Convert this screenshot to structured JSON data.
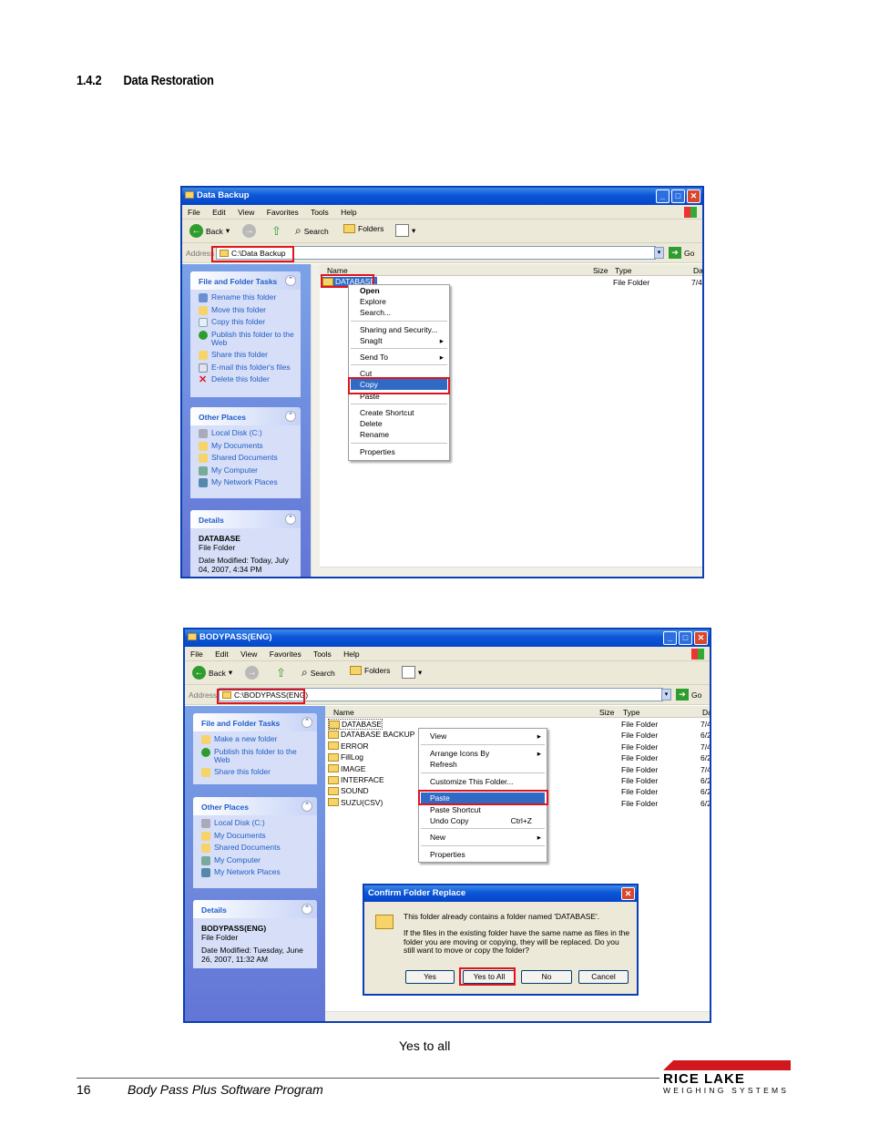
{
  "section": {
    "number": "1.4.2",
    "title": "Data Restoration"
  },
  "win1": {
    "title": "Data Backup",
    "menu": [
      "File",
      "Edit",
      "View",
      "Favorites",
      "Tools",
      "Help"
    ],
    "toolbar": {
      "back": "Back",
      "search": "Search",
      "folders": "Folders"
    },
    "address_label": "Address",
    "address": "C:\\Data Backup",
    "go": "Go",
    "tasks_title": "File and Folder Tasks",
    "tasks": [
      "Rename this folder",
      "Move this folder",
      "Copy this folder",
      "Publish this folder to the Web",
      "Share this folder",
      "E-mail this folder's files",
      "Delete this folder"
    ],
    "other_title": "Other Places",
    "other": [
      "Local Disk (C:)",
      "My Documents",
      "Shared Documents",
      "My Computer",
      "My Network Places"
    ],
    "details_title": "Details",
    "details_name": "DATABASE",
    "details_type": "File Folder",
    "details_date": "Date Modified: Today, July 04, 2007, 4:34 PM",
    "columns": {
      "name": "Name",
      "size": "Size",
      "type": "Type",
      "date": "Da"
    },
    "file": {
      "name": "DATABASE",
      "type": "File Folder",
      "date": "7/4"
    },
    "context": [
      "Open",
      "Explore",
      "Search...",
      "Sharing and Security...",
      "SnagIt",
      "Send To",
      "Cut",
      "Copy",
      "Paste",
      "Create Shortcut",
      "Delete",
      "Rename",
      "Properties"
    ]
  },
  "win2": {
    "title": "BODYPASS(ENG)",
    "menu": [
      "File",
      "Edit",
      "View",
      "Favorites",
      "Tools",
      "Help"
    ],
    "toolbar": {
      "back": "Back",
      "search": "Search",
      "folders": "Folders"
    },
    "address_label": "Address",
    "address": "C:\\BODYPASS(ENG)",
    "go": "Go",
    "tasks_title": "File and Folder Tasks",
    "tasks": [
      "Make a new folder",
      "Publish this folder to the Web",
      "Share this folder"
    ],
    "other_title": "Other Places",
    "other": [
      "Local Disk (C:)",
      "My Documents",
      "Shared Documents",
      "My Computer",
      "My Network Places"
    ],
    "details_title": "Details",
    "details_name": "BODYPASS(ENG)",
    "details_type": "File Folder",
    "details_date": "Date Modified: Tuesday, June 26, 2007, 11:32 AM",
    "columns": {
      "name": "Name",
      "size": "Size",
      "type": "Type",
      "date": "Da"
    },
    "files": [
      {
        "name": "DATABASE",
        "type": "File Folder",
        "date": "7/4"
      },
      {
        "name": "DATABASE BACKUP",
        "type": "File Folder",
        "date": "6/2"
      },
      {
        "name": "ERROR",
        "type": "File Folder",
        "date": "7/4"
      },
      {
        "name": "FillLog",
        "type": "File Folder",
        "date": "6/2"
      },
      {
        "name": "IMAGE",
        "type": "File Folder",
        "date": "7/4"
      },
      {
        "name": "INTERFACE",
        "type": "File Folder",
        "date": "6/2"
      },
      {
        "name": "SOUND",
        "type": "File Folder",
        "date": "6/2"
      },
      {
        "name": "SUZU(CSV)",
        "type": "File Folder",
        "date": "6/2"
      }
    ],
    "context": [
      "View",
      "Arrange Icons By",
      "Refresh",
      "Customize This Folder...",
      "Paste",
      "Paste Shortcut",
      "Undo Copy",
      "New",
      "Properties"
    ],
    "undo_shortcut": "Ctrl+Z",
    "dialog": {
      "title": "Confirm Folder Replace",
      "line1": "This folder already contains a folder named 'DATABASE'.",
      "line2": "If the files in the existing folder have the same name as files in the folder you are moving or copying, they will be replaced.  Do you still want to move or copy the folder?",
      "buttons": [
        "Yes",
        "Yes to All",
        "No",
        "Cancel"
      ]
    }
  },
  "caption": "Yes to all",
  "footer": {
    "page": "16",
    "title": "Body Pass Plus Software Program"
  },
  "logo": {
    "name": "RICE LAKE",
    "sub": "WEIGHING SYSTEMS",
    "brand_color": "#d1181f"
  }
}
